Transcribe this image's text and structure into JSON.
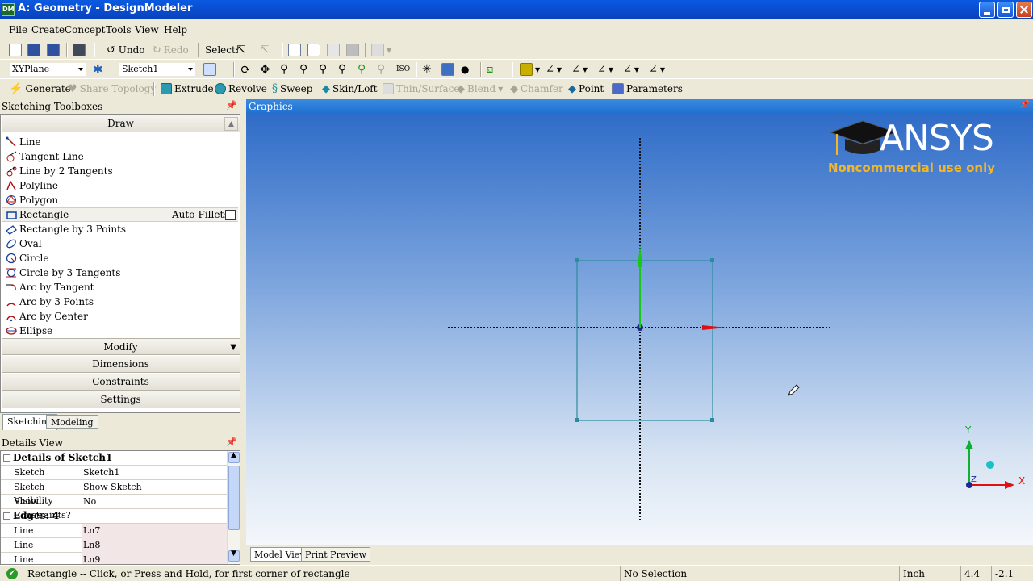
{
  "window": {
    "title": "A: Geometry - DesignModeler",
    "app_icon": "DM"
  },
  "menu": [
    "File",
    "Create",
    "Concept",
    "Tools",
    "View",
    "Help"
  ],
  "toolbar1": {
    "undo": "Undo",
    "redo": "Redo",
    "select_label": "Select:"
  },
  "toolbar2": {
    "plane": "XYPlane",
    "sketch": "Sketch1"
  },
  "toolbar3": {
    "generate": "Generate",
    "share_topology": "Share Topology",
    "extrude": "Extrude",
    "revolve": "Revolve",
    "sweep": "Sweep",
    "skin_loft": "Skin/Loft",
    "thin_surface": "Thin/Surface",
    "blend": "Blend",
    "chamfer": "Chamfer",
    "point": "Point",
    "parameters": "Parameters"
  },
  "toolbox": {
    "title": "Sketching Toolboxes",
    "draw_group": "Draw",
    "draw_items": [
      "Line",
      "Tangent Line",
      "Line by 2 Tangents",
      "Polyline",
      "Polygon",
      "Rectangle",
      "Rectangle by 3 Points",
      "Oval",
      "Circle",
      "Circle by 3 Tangents",
      "Arc by Tangent",
      "Arc by 3 Points",
      "Arc by Center",
      "Ellipse"
    ],
    "auto_fillet": "Auto-Fillet:",
    "groups": [
      "Modify",
      "Dimensions",
      "Constraints",
      "Settings"
    ]
  },
  "panel_tabs": [
    "Sketching",
    "Modeling"
  ],
  "details": {
    "title": "Details View",
    "section1": "Details of Sketch1",
    "rows1": [
      {
        "k": "Sketch",
        "v": "Sketch1"
      },
      {
        "k": "Sketch Visibility",
        "v": "Show Sketch"
      },
      {
        "k": "Show Constraints?",
        "v": "No"
      }
    ],
    "section2": "Edges: 4",
    "rows2": [
      {
        "k": "Line",
        "v": "Ln7"
      },
      {
        "k": "Line",
        "v": "Ln8"
      },
      {
        "k": "Line",
        "v": "Ln9"
      }
    ]
  },
  "graphics": {
    "title": "Graphics",
    "logo": "ANSYS",
    "logo_note": "Noncommercial use only",
    "axis_x": "X",
    "axis_y": "Y",
    "axis_z": "Z"
  },
  "view_tabs": [
    "Model View",
    "Print Preview"
  ],
  "status": {
    "hint": "Rectangle -- Click, or Press and Hold, for first corner of rectangle",
    "selection": "No Selection",
    "units": "Inch",
    "x": "4.4",
    "y": "-2.1"
  },
  "colors": {
    "titlebar": "#0a4fd6",
    "graphics_top": "#2f6cc8",
    "sketch_line": "#2c8c9c",
    "x_axis": "#e01010",
    "y_axis": "#10b030",
    "logo_accent": "#f3b62a"
  }
}
